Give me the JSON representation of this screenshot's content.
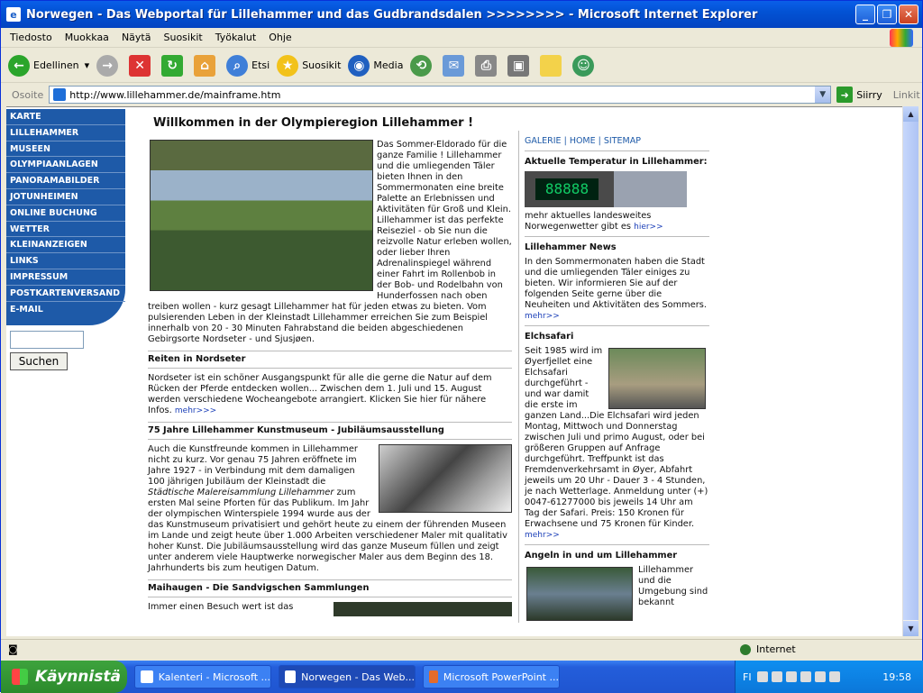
{
  "window": {
    "title": "Norwegen - Das Webportal für Lillehammer und das Gudbrandsdalen >>>>>>>> - Microsoft Internet Explorer"
  },
  "menu": [
    "Tiedosto",
    "Muokkaa",
    "Näytä",
    "Suosikit",
    "Työkalut",
    "Ohje"
  ],
  "toolbar": {
    "back": "Edellinen",
    "search": "Etsi",
    "favorites": "Suosikit",
    "media": "Media"
  },
  "address": {
    "label": "Osoite",
    "url": "http://www.lillehammer.de/mainframe.htm",
    "go": "Siirry",
    "links": "Linkit"
  },
  "nav": [
    "KARTE",
    "LILLEHAMMER",
    "MUSEEN",
    "OLYMPIAANLAGEN",
    "PANORAMABILDER",
    "JOTUNHEIMEN",
    "ONLINE BUCHUNG",
    "WETTER",
    "KLEINANZEIGEN",
    "LINKS",
    "IMPRESSUM",
    "POSTKARTENVERSAND",
    "E-MAIL"
  ],
  "search_button": "Suchen",
  "main": {
    "title": "Willkommen in der Olympieregion Lillehammer !",
    "intro": "Das Sommer-Eldorado für die ganze Familie ! Lillehammer und die umliegenden Täler bieten Ihnen in den Sommermonaten eine breite Palette an Erlebnissen und Aktivitäten für Groß und Klein. Lillehammer ist das perfekte Reiseziel - ob Sie nun die reizvolle Natur erleben wollen, oder lieber Ihren Adrenalinspiegel während einer Fahrt im Rollenbob in der Bob- und Rodelbahn von Hunderfossen nach oben treiben wollen - kurz gesagt Lillehammer hat für jeden etwas zu bieten. Vom pulsierenden Leben in der Kleinstadt Lillehammer erreichen Sie zum Beispiel innerhalb von 20 - 30 Minuten Fahrabstand die beiden abgeschiedenen Gebirgsorte Nordseter - und Sjusjøen.",
    "sec1_title": "Reiten in Nordseter",
    "sec1_text": "Nordseter ist ein schöner Ausgangspunkt für alle die gerne die Natur auf dem Rücken der Pferde entdecken wollen... Zwischen dem 1. Juli und 15. August werden verschiedene Wocheangebote arrangiert. Klicken Sie hier für nähere Infos.",
    "sec1_more": "mehr>>>",
    "sec2_title": "75 Jahre Lillehammer Kunstmuseum - Jubiläumsausstellung",
    "sec2_text_a": "Auch die Kunstfreunde kommen in Lillehammer nicht zu kurz. Vor genau 75 Jahren eröffnete im Jahre 1927 - in Verbindung mit dem damaligen 100 jährigen Jubiläum der Kleinstadt die",
    "sec2_text_em": "Städtische Malereisammlung Lillehammer",
    "sec2_text_b": "zum ersten Mal seine Pforten für das Publikum. Im Jahr der olympischen Winterspiele 1994 wurde aus der das Kunstmuseum privatisiert und gehört heute zu einem der führenden Museen im Lande und zeigt heute über 1.000 Arbeiten verschiedener Maler mit qualitativ hoher Kunst. Die Jubiläumsausstellung wird das ganze Museum füllen und zeigt unter anderem viele Hauptwerke norwegischer Maler aus dem Beginn des 18. Jahrhunderts bis zum heutigen Datum.",
    "sec3_title": "Maihaugen - Die Sandvigschen Sammlungen",
    "sec3_text": "Immer einen Besuch wert ist das"
  },
  "right": {
    "toplinks": [
      "GALERIE",
      "HOME",
      "SITEMAP"
    ],
    "temp_title": "Aktuelle Temperatur in Lillehammer:",
    "temp_display": "88888",
    "temp_more": "mehr aktuelles landesweites Norwegenwetter gibt es",
    "temp_link": "hier>>",
    "news_title": "Lillehammer News",
    "news_text": "In den Sommermonaten haben die Stadt und die umliegenden Täler einiges zu bieten. Wir informieren Sie auf der folgenden Seite gerne über die Neuheiten und Aktivitäten des Sommers.",
    "news_more": "mehr>>",
    "elch_title": "Elchsafari",
    "elch_text": "Seit 1985 wird im Øyerfjellet eine Elchsafari durchgeführt - und war damit die erste im ganzen Land...Die Elchsafari wird jeden Montag, Mittwoch und Donnerstag zwischen Juli und primo August, oder bei größeren Gruppen auf Anfrage durchgeführt. Treffpunkt ist das Fremdenverkehrsamt in Øyer, Abfahrt jeweils um 20 Uhr - Dauer 3 - 4 Stunden, je nach Wetterlage. Anmeldung unter (+) 0047-61277000 bis jeweils 14 Uhr am Tag der Safari. Preis: 150 Kronen für Erwachsene und 75 Kronen für Kinder.",
    "elch_more": "mehr>>",
    "angeln_title": "Angeln in und um Lillehammer",
    "angeln_text": "Lillehammer und die Umgebung sind bekannt"
  },
  "status": {
    "zone": "Internet"
  },
  "taskbar": {
    "start": "Käynnistä",
    "tasks": [
      "Kalenteri - Microsoft ...",
      "Norwegen - Das Web...",
      "Microsoft PowerPoint ..."
    ],
    "lang": "FI",
    "clock": "19:58"
  }
}
